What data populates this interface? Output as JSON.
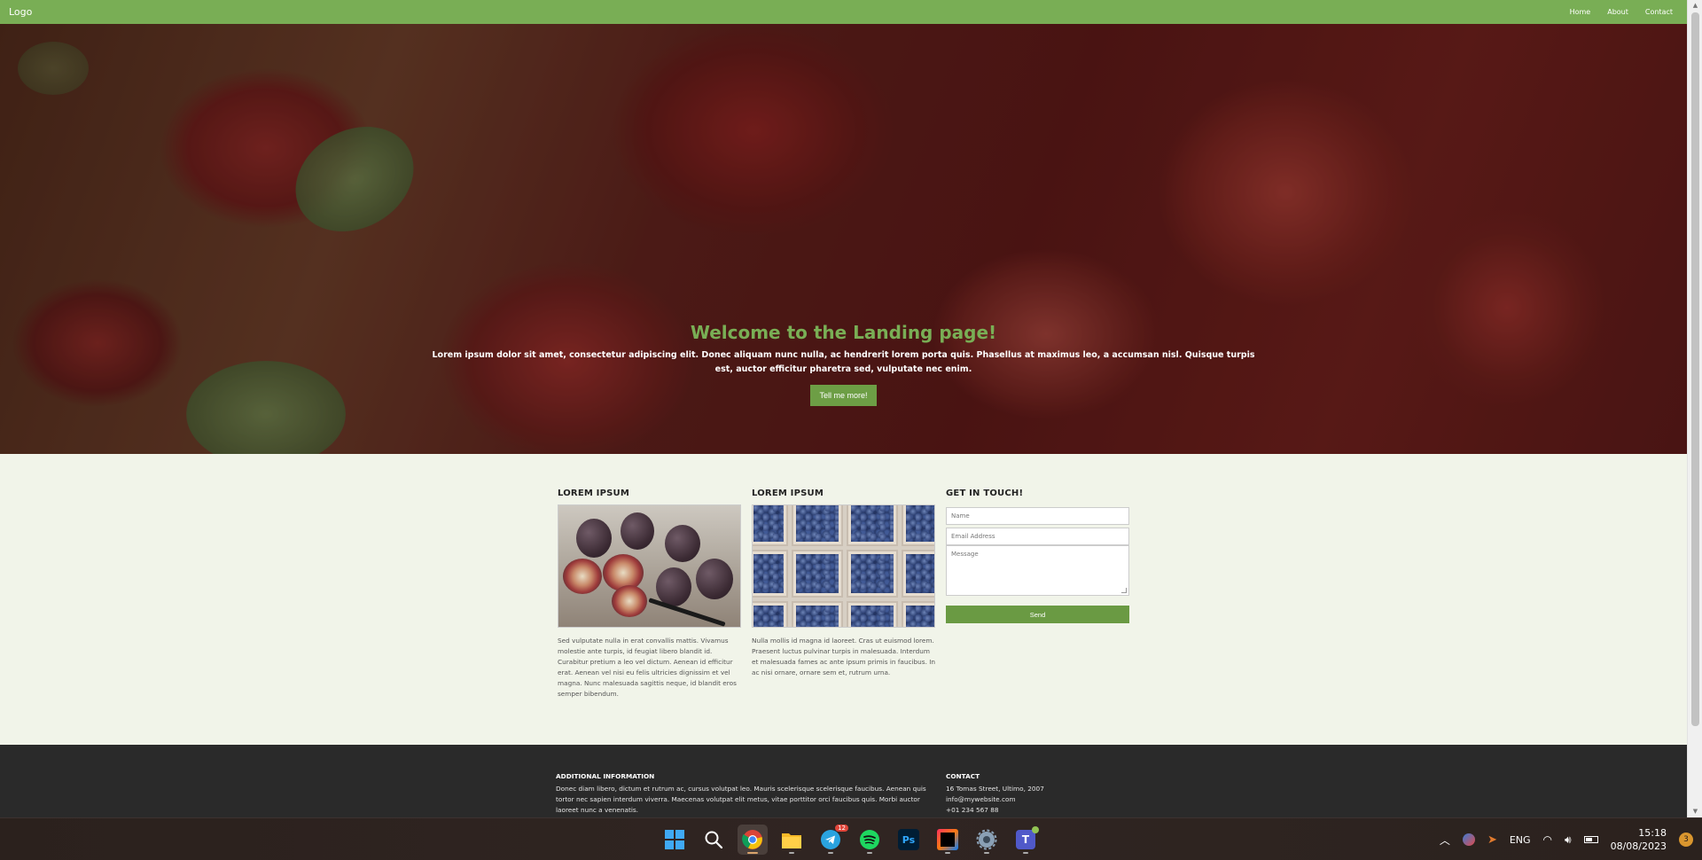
{
  "nav": {
    "logo": "Logo",
    "links": [
      "Home",
      "About",
      "Contact"
    ]
  },
  "hero": {
    "title": "Welcome to the Landing page!",
    "text": "Lorem ipsum dolor sit amet, consectetur adipiscing elit. Donec aliquam nunc nulla, ac hendrerit lorem porta quis. Phasellus at maximus leo, a accumsan nisl. Quisque turpis est, auctor efficitur pharetra sed, vulputate nec enim.",
    "button": "Tell me more!"
  },
  "columns": [
    {
      "heading": "LOREM IPSUM",
      "text": "Sed vulputate nulla in erat convallis mattis. Vivamus molestie ante turpis, id feugiat libero blandit id. Curabitur pretium a leo vel dictum. Aenean id efficitur erat. Aenean vel nisi eu felis ultricies dignissim et vel magna. Nunc malesuada sagittis neque, id blandit eros semper bibendum."
    },
    {
      "heading": "LOREM IPSUM",
      "text": "Nulla mollis id magna id laoreet. Cras ut euismod lorem. Praesent luctus pulvinar turpis in malesuada. Interdum et malesuada fames ac ante ipsum primis in faucibus. In ac nisi ornare, ornare sem et, rutrum urna."
    }
  ],
  "contact_form": {
    "heading": "GET IN TOUCH!",
    "name_placeholder": "Name",
    "email_placeholder": "Email Address",
    "message_placeholder": "Message",
    "send_label": "Send"
  },
  "footer": {
    "info_heading": "ADDITIONAL INFORMATION",
    "info_text": "Donec diam libero, dictum et rutrum ac, cursus volutpat leo. Mauris scelerisque scelerisque faucibus. Aenean quis tortor nec sapien interdum viverra. Maecenas volutpat elit metus, vitae porttitor orci faucibus quis. Morbi auctor laoreet nunc a venenatis.",
    "contact_heading": "CONTACT",
    "address": "16 Tomas Street, Ultimo, 2007",
    "email": "info@mywebsite.com",
    "phone": "+01 234 567 88"
  },
  "taskbar": {
    "apps": [
      "windows-start-icon",
      "search-icon",
      "chrome-icon",
      "file-explorer-icon",
      "telegram-icon",
      "spotify-icon",
      "photoshop-icon",
      "intellij-icon",
      "settings-icon",
      "teams-icon"
    ],
    "telegram_badge": "12",
    "photoshop_label": "Ps",
    "language": "ENG",
    "time": "15:18",
    "date": "08/08/2023",
    "notifications": "3"
  },
  "colors": {
    "accent": "#79ae55",
    "button": "#6a9a43",
    "footer": "#2a2a2a",
    "page_bg": "#f1f4e9"
  }
}
